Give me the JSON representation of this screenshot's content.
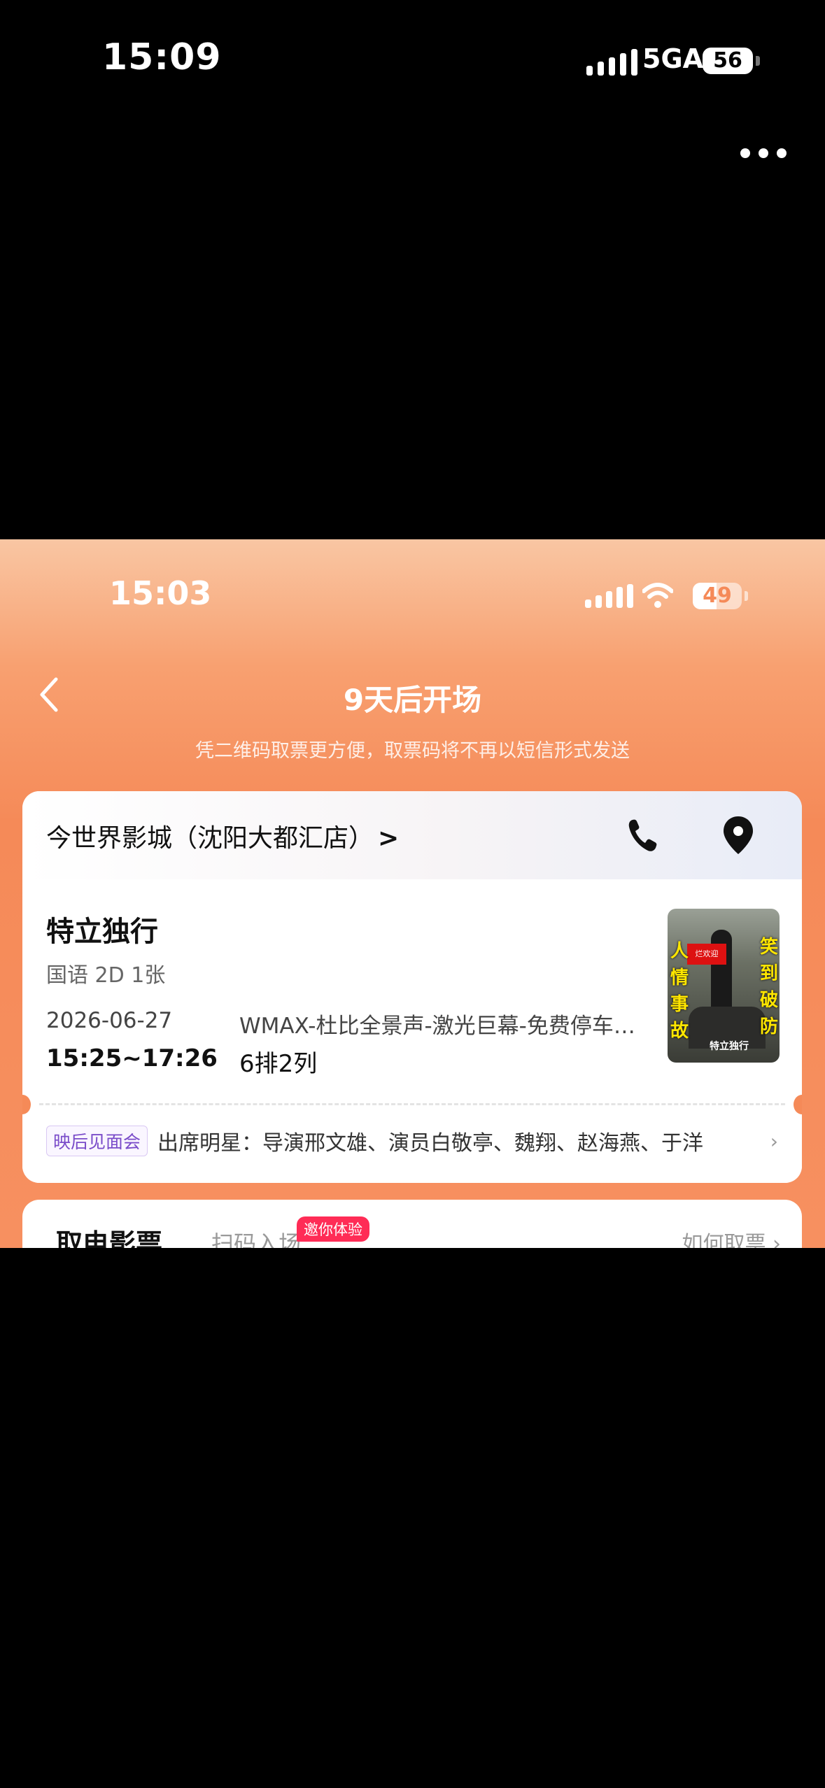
{
  "outer_status": {
    "time": "15:09",
    "network": "5GA",
    "battery": "56"
  },
  "screenshot": {
    "status": {
      "time": "15:03",
      "battery": "49",
      "battery_level": 0.49
    },
    "nav": {
      "title": "9天后开场",
      "subtitle": "凭二维码取票更方便，取票码将不再以短信形式发送"
    },
    "cinema": {
      "name": "今世界影城（沈阳大都汇店）",
      "chevron": ">"
    },
    "movie": {
      "title": "特立独行",
      "meta": "国语 2D 1张",
      "date": "2026-06-27",
      "time": "15:25~17:26",
      "hall": "WMAX-杜比全景声-激光巨幕-免费停车…",
      "seat": "6排2列",
      "poster": {
        "left_text": "人情事故",
        "right_text": "笑到破防",
        "tag": "烂欢迎",
        "name": "特立独行"
      }
    },
    "event": {
      "badge": "映后见面会",
      "text": "出席明星：导演邢文雄、演员白敬亭、魏翔、赵海燕、于洋",
      "chevron": "›"
    },
    "ticket": {
      "title": "取电影票",
      "scan": "扫码入场",
      "badge": "邀你体验",
      "how": "如何取票 ›"
    }
  },
  "colors": {
    "accent": "#f58a58",
    "event_badge": "#7a4cc9",
    "invite_badge": "#ff2c56"
  }
}
